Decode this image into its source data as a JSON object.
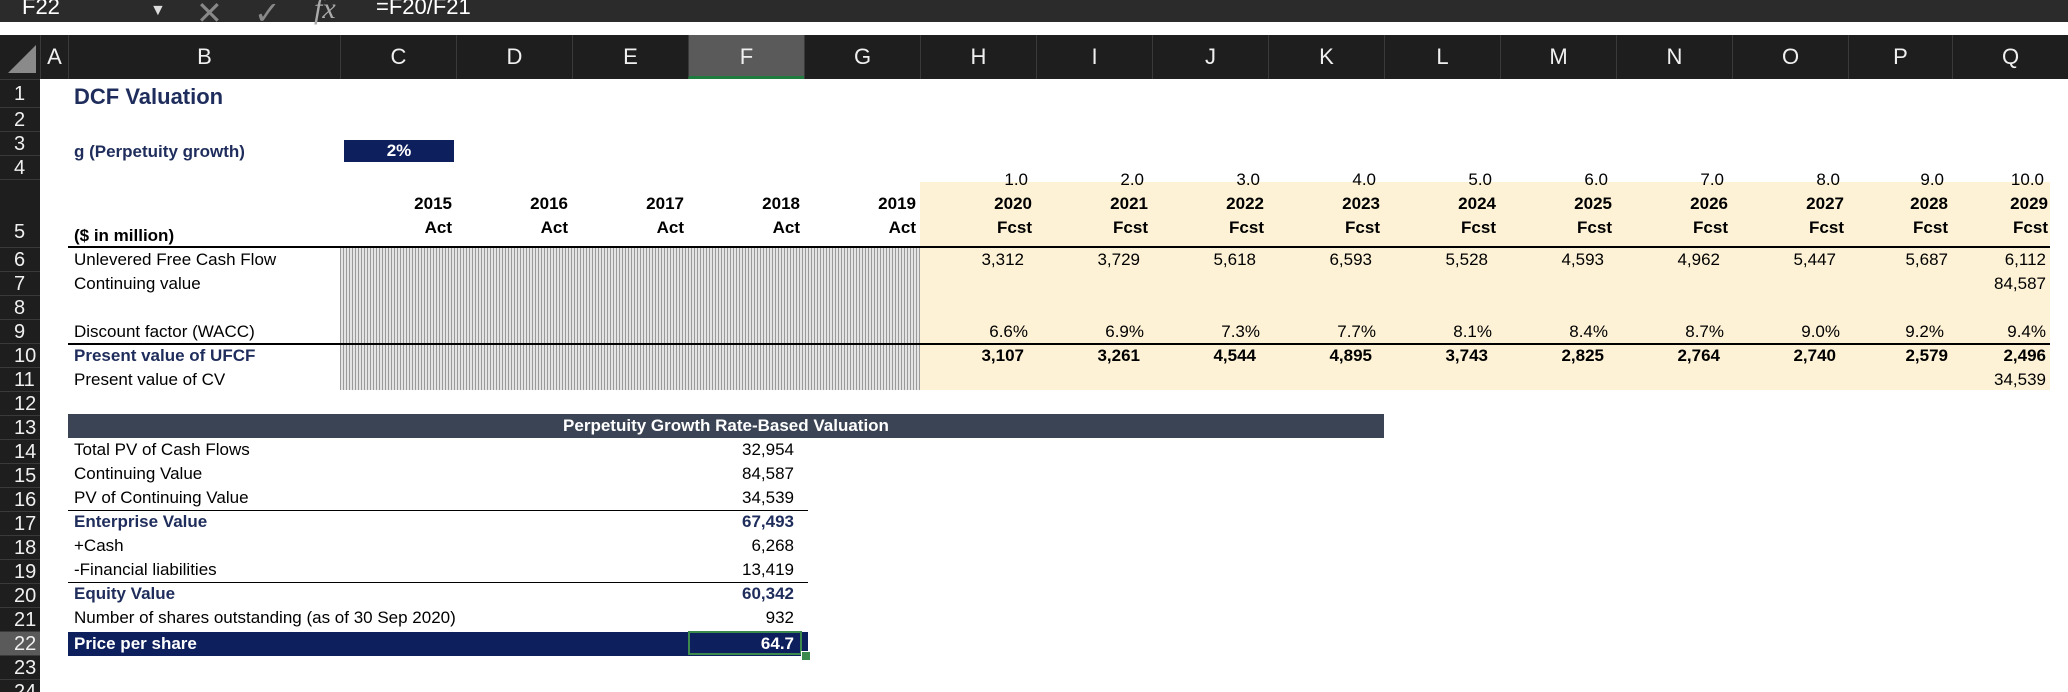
{
  "formula_bar": {
    "name_box": "F22",
    "formula": "=F20/F21",
    "cancel_icon": "x-icon",
    "enter_icon": "check-icon",
    "fx_label": "fx"
  },
  "columns": [
    "A",
    "B",
    "C",
    "D",
    "E",
    "F",
    "G",
    "H",
    "I",
    "J",
    "K",
    "L",
    "M",
    "N",
    "O",
    "P",
    "Q"
  ],
  "selected_column": "F",
  "rows": [
    "1",
    "2",
    "3",
    "4",
    "5",
    "6",
    "7",
    "8",
    "9",
    "10",
    "11",
    "12",
    "13",
    "14",
    "15",
    "16",
    "17",
    "18",
    "19",
    "20",
    "21",
    "22",
    "23",
    "24"
  ],
  "selected_row": "22",
  "sheet": {
    "title": "DCF Valuation",
    "g_label": "g (Perpetuity growth)",
    "g_value": "2%",
    "unit_label": "($ in million)",
    "period_index": [
      "1.0",
      "2.0",
      "3.0",
      "4.0",
      "5.0",
      "6.0",
      "7.0",
      "8.0",
      "9.0",
      "10.0"
    ],
    "years": [
      "2015",
      "2016",
      "2017",
      "2018",
      "2019",
      "2020",
      "2021",
      "2022",
      "2023",
      "2024",
      "2025",
      "2026",
      "2027",
      "2028",
      "2029"
    ],
    "year_types": [
      "Act",
      "Act",
      "Act",
      "Act",
      "Act",
      "Fcst",
      "Fcst",
      "Fcst",
      "Fcst",
      "Fcst",
      "Fcst",
      "Fcst",
      "Fcst",
      "Fcst",
      "Fcst"
    ],
    "row_labels": {
      "ufcf": "Unlevered Free Cash Flow",
      "cv": "Continuing value",
      "discount": "Discount factor (WACC)",
      "pv_ufcf": "Present value of UFCF",
      "pv_cv": "Present value of CV"
    },
    "ufcf": [
      "3,312",
      "3,729",
      "5,618",
      "6,593",
      "5,528",
      "4,593",
      "4,962",
      "5,447",
      "5,687",
      "6,112"
    ],
    "cv": "84,587",
    "discount": [
      "6.6%",
      "6.9%",
      "7.3%",
      "7.7%",
      "8.1%",
      "8.4%",
      "8.7%",
      "9.0%",
      "9.2%",
      "9.4%"
    ],
    "pv_ufcf": [
      "3,107",
      "3,261",
      "4,544",
      "4,895",
      "3,743",
      "2,825",
      "2,764",
      "2,740",
      "2,579",
      "2,496"
    ],
    "pv_cv": "34,539"
  },
  "summary": {
    "header": "Perpetuity Growth Rate-Based Valuation",
    "items": [
      {
        "label": "Total PV of Cash Flows",
        "value": "32,954"
      },
      {
        "label": "Continuing Value",
        "value": "84,587"
      },
      {
        "label": "PV of Continuing Value",
        "value": "34,539"
      },
      {
        "label": "Enterprise Value",
        "value": "67,493"
      },
      {
        "label": "+Cash",
        "value": "6,268"
      },
      {
        "label": "-Financial liabilities",
        "value": "13,419"
      },
      {
        "label": "Equity Value",
        "value": "60,342"
      },
      {
        "label": "Number of shares outstanding (as of 30 Sep 2020)",
        "value": "932"
      },
      {
        "label": "Price per share",
        "value": "64.7"
      }
    ]
  }
}
